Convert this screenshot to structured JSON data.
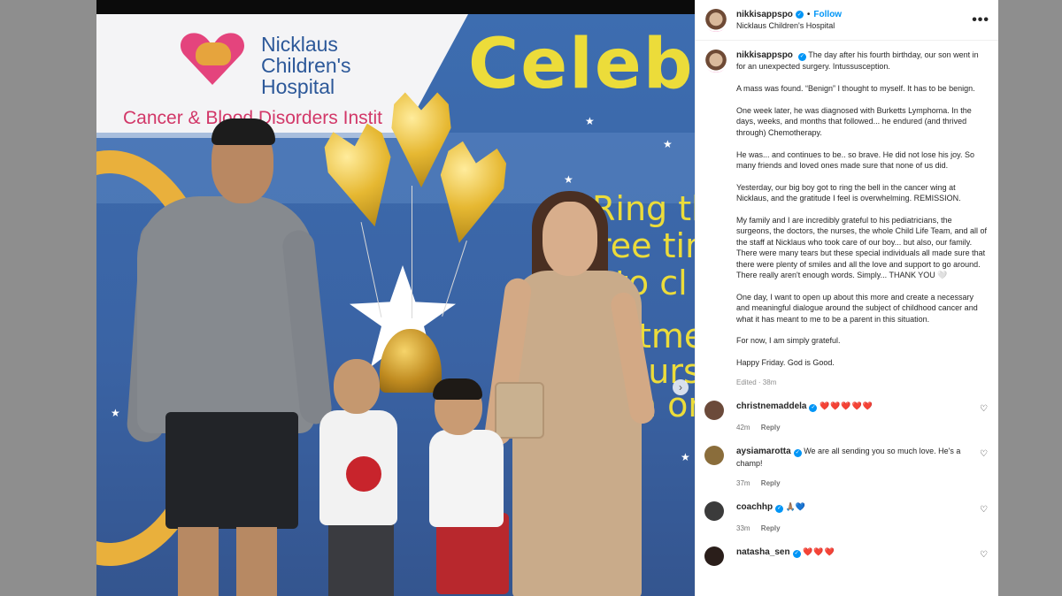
{
  "post": {
    "username": "nikkisappspo",
    "follow_label": "Follow",
    "dot": "•",
    "location": "Nicklaus Children's Hospital",
    "more_label": "•••",
    "next_label": "›",
    "verified_mark": "✓"
  },
  "photo": {
    "hospital_line1": "Nicklaus",
    "hospital_line2": "Children's",
    "hospital_line3": "Hospital",
    "institute": "Cancer & Blood Disorders Instit",
    "celebrate": "Celeb",
    "wall_words": [
      "Ring thi",
      "ree tim",
      "to cl",
      "tmen",
      "ours",
      "m on",
      ""
    ]
  },
  "caption": {
    "username": "nikkisappspo",
    "paragraphs": [
      "The day after his fourth birthday, our son went in for an unexpected surgery. Intussusception.",
      "A mass was found. “Benign” I thought to myself. It has to be benign.",
      "One week later, he was diagnosed with Burketts Lymphoma. In the days, weeks, and months that followed... he endured (and thrived through) Chemotherapy.",
      "He was... and continues to be.. so brave. He did not lose his joy. So many friends and loved ones made sure that none of us did.",
      "Yesterday, our big boy got to ring the bell in the cancer wing at Nicklaus, and the gratitude I feel is overwhelming. REMISSION.",
      "My family and I are incredibly grateful to his pediatricians, the surgeons, the doctors, the nurses, the whole Child Life Team, and all of the staff at Nicklaus who took care of our boy... but also, our family. There were many tears but these special individuals all made sure that there were plenty of smiles and all the love and support to go around. There really aren't enough words. Simply... THANK YOU 🤍",
      "One day, I want to open up about this more and create a necessary and meaningful dialogue around the subject of childhood cancer and what it has meant to me to be a parent in this situation.",
      "For now, I am simply grateful.",
      "Happy Friday. God is Good."
    ],
    "edited": "Edited · 38m"
  },
  "comments": [
    {
      "username": "christnemaddela",
      "text": "❤️❤️❤️❤️❤️",
      "time": "42m",
      "reply": "Reply",
      "avatar_color": "#6b4a3a"
    },
    {
      "username": "aysiamarotta",
      "text": "We are all sending you so much love. He's a champ!",
      "time": "37m",
      "reply": "Reply",
      "avatar_color": "#8a6d3b"
    },
    {
      "username": "coachhp",
      "text": "🙏🏽💙",
      "time": "33m",
      "reply": "Reply",
      "avatar_color": "#3b3b3b"
    },
    {
      "username": "natasha_sen",
      "text": "❤️❤️❤️",
      "time": "",
      "reply": "",
      "avatar_color": "#2a1e1a"
    }
  ],
  "icons": {
    "like": "♡"
  }
}
